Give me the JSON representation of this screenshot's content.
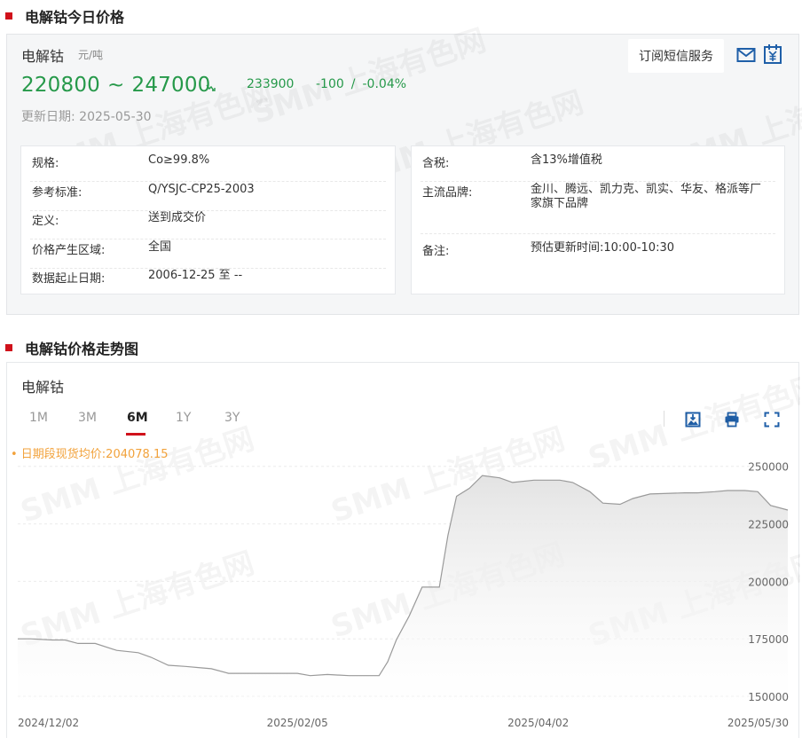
{
  "section1": {
    "title": "电解钴今日价格"
  },
  "price": {
    "name": "电解钴",
    "unit": "元/吨",
    "low": "220800",
    "tilde": "~",
    "high": "247000",
    "avg": "233900",
    "change": "-100",
    "change_sep": "/",
    "change_pct": "-0.04%",
    "update_label": "更新日期:",
    "update_date": "2025-05-30",
    "subscribe_label": "订阅短信服务",
    "color_down": "#26994a"
  },
  "info_left": [
    {
      "key": "规格:",
      "value": "Co≥99.8%"
    },
    {
      "key": "参考标准:",
      "value": "Q/YSJC-CP25-2003"
    },
    {
      "key": "定义:",
      "value": "送到成交价"
    },
    {
      "key": "价格产生区域:",
      "value": "全国"
    },
    {
      "key": "数据起止日期:",
      "value": "2006-12-25 至 --"
    }
  ],
  "info_right": [
    {
      "key": "含税:",
      "value": "含13%增值税"
    },
    {
      "key": "主流品牌:",
      "value_line1": "金川、腾远、凯力克、凯实、华友、格派等厂",
      "value_line2": "家旗下品牌"
    },
    {
      "key": "备注:",
      "value": "预估更新时间:10:00-10:30"
    }
  ],
  "section2": {
    "title": "电解钴价格走势图"
  },
  "chart_panel": {
    "name": "电解钴",
    "tabs": [
      "1M",
      "3M",
      "6M",
      "1Y",
      "3Y"
    ],
    "active_tab": "6M",
    "avg_label": "• 日期段现货均价:204078.15",
    "watermark": "SMM 上海有色网"
  },
  "icons": {
    "trend": "arrow-down-icon",
    "mail": "mail-icon",
    "calendar": "yuan-calendar-icon",
    "download": "download-image-icon",
    "print": "printer-icon",
    "fullscreen": "fullscreen-icon"
  },
  "chart_data": {
    "type": "area",
    "x_ticks": [
      "2024/12/02",
      "2025/02/05",
      "2025/04/02",
      "2025/05/30"
    ],
    "y_ticks": [
      250000,
      225000,
      200000,
      175000,
      150000
    ],
    "ylim": [
      145000,
      258000
    ],
    "grid": true,
    "line_color": "#9a9a9a",
    "fill_color": "#e3e3e3",
    "x": [
      "2024/12/02",
      "2024/12/05",
      "2024/12/10",
      "2024/12/13",
      "2024/12/16",
      "2024/12/20",
      "2024/12/25",
      "2024/12/30",
      "2025/01/02",
      "2025/01/06",
      "2025/01/10",
      "2025/01/13",
      "2025/01/16",
      "2025/01/20",
      "2025/01/24",
      "2025/01/27",
      "2025/02/05",
      "2025/02/08",
      "2025/02/12",
      "2025/02/17",
      "2025/02/20",
      "2025/02/24",
      "2025/02/26",
      "2025/02/28",
      "2025/03/03",
      "2025/03/06",
      "2025/03/10",
      "2025/03/12",
      "2025/03/14",
      "2025/03/17",
      "2025/03/20",
      "2025/03/24",
      "2025/03/27",
      "2025/04/01",
      "2025/04/03",
      "2025/04/07",
      "2025/04/10",
      "2025/04/14",
      "2025/04/17",
      "2025/04/21",
      "2025/04/24",
      "2025/04/28",
      "2025/05/06",
      "2025/05/09",
      "2025/05/13",
      "2025/05/16",
      "2025/05/20",
      "2025/05/23",
      "2025/05/26",
      "2025/05/30"
    ],
    "values": [
      175000,
      175000,
      174500,
      174500,
      173000,
      173000,
      170000,
      169000,
      167000,
      163500,
      163000,
      162500,
      162000,
      160000,
      160000,
      160000,
      160000,
      159000,
      159500,
      159000,
      159000,
      159000,
      165000,
      174500,
      185000,
      197500,
      197500,
      220000,
      237000,
      240500,
      246000,
      245000,
      243000,
      244000,
      244000,
      244000,
      243000,
      239000,
      234000,
      233500,
      236000,
      238000,
      238500,
      238500,
      239000,
      239500,
      239500,
      239000,
      233000,
      231000
    ]
  }
}
